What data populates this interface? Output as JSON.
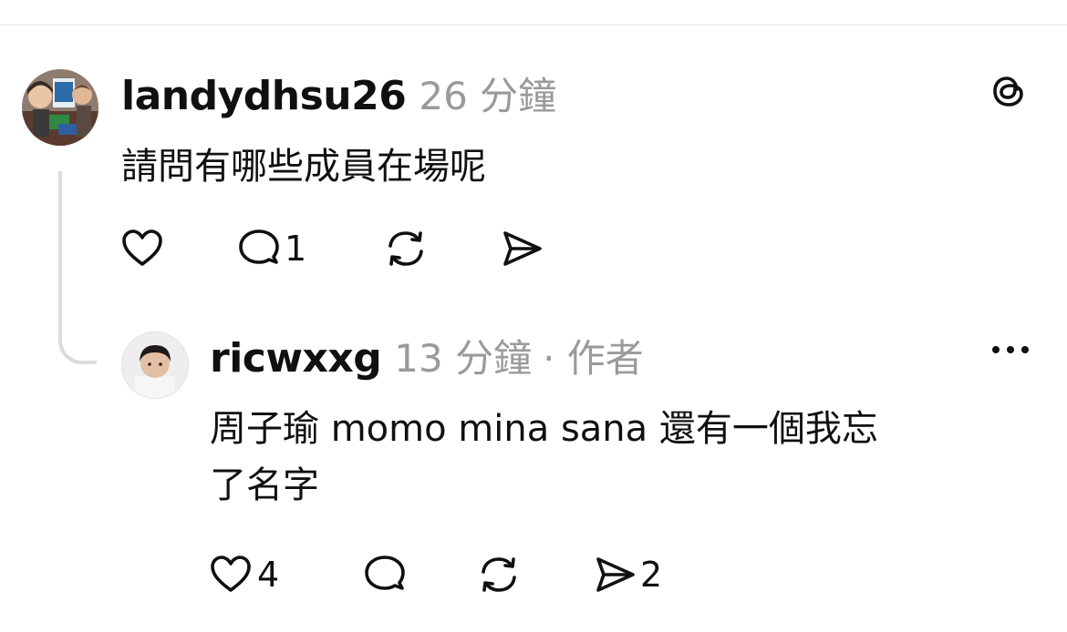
{
  "thread": {
    "parent_comment": {
      "username": "landydhsu26",
      "time": "26 分鐘",
      "text": "請問有哪些成員在場呢",
      "likes": "",
      "replies": "1",
      "reposts": "",
      "shares": ""
    },
    "reply_comment": {
      "username": "ricwxxg",
      "time": "13 分鐘",
      "author_badge": "· 作者",
      "text_line1": "周子瑜 momo mina sana 還有一個我忘",
      "text_line2": "了名字",
      "likes": "4",
      "replies": "",
      "reposts": "",
      "shares": "2"
    }
  },
  "icons": {
    "brand": "threads-logo-icon",
    "like": "heart-icon",
    "reply": "comment-bubble-icon",
    "repost": "repost-arrows-icon",
    "share": "send-paper-plane-icon",
    "more": "more-dots-icon"
  },
  "colors": {
    "text": "#101010",
    "secondary_text": "#9a9a9a",
    "thread_line": "#dcdcdc"
  }
}
